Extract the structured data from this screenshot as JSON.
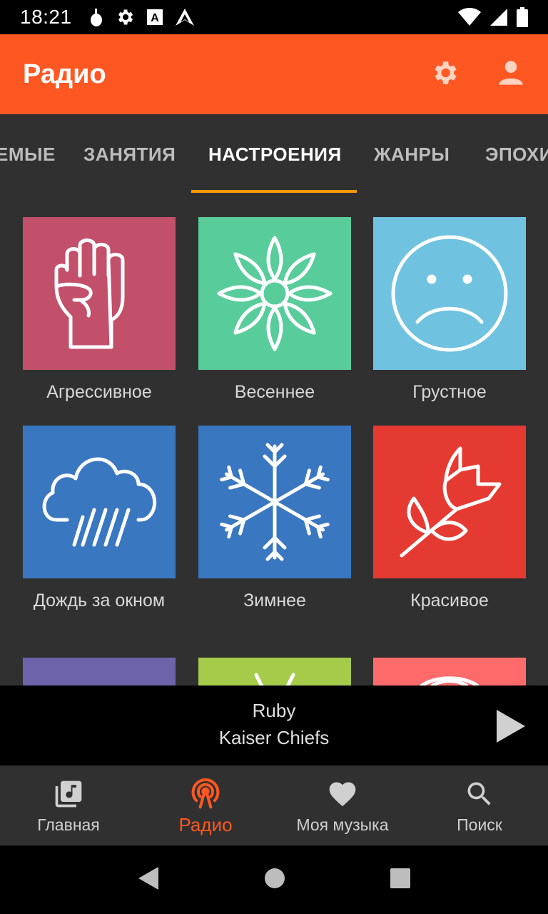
{
  "status_bar": {
    "time": "18:21"
  },
  "app_bar": {
    "title": "Радио"
  },
  "tabs": [
    {
      "label": "ЕМЫЕ"
    },
    {
      "label": "ЗАНЯТИЯ"
    },
    {
      "label": "НАСТРОЕНИЯ",
      "active": true
    },
    {
      "label": "ЖАНРЫ"
    },
    {
      "label": "ЭПОХИ"
    }
  ],
  "moods": [
    {
      "label": "Агрессивное",
      "color": "#c2506a",
      "icon": "fist-icon"
    },
    {
      "label": "Весеннее",
      "color": "#59cc9c",
      "icon": "flower-icon"
    },
    {
      "label": "Грустное",
      "color": "#6fc3e0",
      "icon": "sad-face-icon"
    },
    {
      "label": "Дождь за окном",
      "color": "#3a77c1",
      "icon": "rain-cloud-icon"
    },
    {
      "label": "Зимнее",
      "color": "#3a77c1",
      "icon": "snowflake-icon"
    },
    {
      "label": "Красивое",
      "color": "#e53a32",
      "icon": "tulip-icon"
    },
    {
      "label": "",
      "color": "#6b64aa",
      "icon": ""
    },
    {
      "label": "",
      "color": "#a6cb4b",
      "icon": ""
    },
    {
      "label": "",
      "color": "#ff6b6b",
      "icon": ""
    }
  ],
  "player": {
    "track": "Ruby",
    "artist": "Kaiser Chiefs"
  },
  "bottom_nav": [
    {
      "label": "Главная",
      "icon": "library-music-icon"
    },
    {
      "label": "Радио",
      "icon": "radio-tower-icon",
      "active": true
    },
    {
      "label": "Моя музыка",
      "icon": "heart-icon"
    },
    {
      "label": "Поиск",
      "icon": "search-icon"
    }
  ],
  "colors": {
    "accent": "#ff5722",
    "tab_indicator": "#ff9800",
    "background": "#303030"
  }
}
